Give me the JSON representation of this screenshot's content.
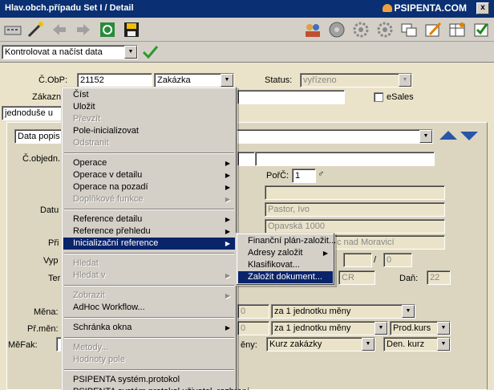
{
  "titlebar": {
    "title": "Hlav.obch.případu  Set I / Detail",
    "logo": "PSIPENTA.COM",
    "close": "x"
  },
  "toolbar": {
    "icons": [
      "keyboard-icon",
      "wand-icon",
      "arrow-left-icon",
      "arrow-right-icon",
      "refresh-icon",
      "save-icon",
      "users-icon",
      "disc-icon",
      "gear-icon",
      "gear2-icon",
      "windows-icon",
      "edit-icon",
      "table-icon",
      "check-doc-icon"
    ]
  },
  "action_bar": {
    "select_value": "Kontrolovat a načíst data",
    "confirm_icon": "checkmark-icon"
  },
  "header": {
    "cobp_label": "Č.ObP:",
    "cobp_value": "21152",
    "type_value": "Zakázka",
    "status_label": "Status:",
    "status_value": "vyřízeno",
    "customer_label": "Zákazník",
    "esales_label": "eSales",
    "mode_value": "jednoduše u"
  },
  "panel": {
    "data_select": "Data popis",
    "objedn_label": "Č.objedn.",
    "porc_label": "PořČ:",
    "porc_value": "1",
    "datum_label": "Datu",
    "contact_value": "Pastor, Ivo",
    "street_value": "Opavská 1000",
    "prijemce_label": "Při",
    "city_value": "c nad Moravicí",
    "vyp_label": "Vyp",
    "slash": "/",
    "vyp_value2": "0",
    "ter_label": "Ter",
    "country_value": "CR",
    "dan_label": "Daň:",
    "dan_value": "22",
    "mena_label": "Měna:",
    "mena_value": "0",
    "mena_unit": "za 1 jednotku měny",
    "prmen_label": "Př.měn:",
    "prmen_value": "0",
    "prmen_unit": "za 1 jednotku měny",
    "prod_kurs": "Prod.kurs",
    "mefak_label": "MěFak:",
    "meny_label": "ěny:",
    "kurs_zakazky": "Kurz zakázky",
    "den_kurz": "Den. kurz"
  },
  "context_menu": {
    "items": [
      {
        "label": "Číst",
        "disabled": false
      },
      {
        "label": "Uložit",
        "disabled": false
      },
      {
        "label": "Převzít",
        "disabled": true
      },
      {
        "label": "Pole-inicializovat",
        "disabled": false
      },
      {
        "label": "Odstranit",
        "disabled": true
      },
      {
        "sep": true
      },
      {
        "label": "Operace",
        "disabled": false,
        "sub": true
      },
      {
        "label": "Operace v detailu",
        "disabled": false,
        "sub": true
      },
      {
        "label": "Operace na pozadí",
        "disabled": false,
        "sub": true
      },
      {
        "label": "Doplňkové funkce",
        "disabled": true,
        "sub": true
      },
      {
        "sep": true
      },
      {
        "label": "Reference detailu",
        "disabled": false,
        "sub": true
      },
      {
        "label": "Reference přehledu",
        "disabled": false,
        "sub": true
      },
      {
        "label": "Inicializační reference",
        "disabled": false,
        "sub": true,
        "selected": true
      },
      {
        "sep": true
      },
      {
        "label": "Hledat",
        "disabled": true
      },
      {
        "label": "Hledat v",
        "disabled": true,
        "sub": true
      },
      {
        "sep": true
      },
      {
        "label": "Zobrazit",
        "disabled": true,
        "sub": true
      },
      {
        "label": "AdHoc Workflow...",
        "disabled": false
      },
      {
        "sep": true
      },
      {
        "label": "Schránka okna",
        "disabled": false,
        "sub": true
      },
      {
        "sep": true
      },
      {
        "label": "Metody...",
        "disabled": true
      },
      {
        "label": "Hodnoty pole",
        "disabled": true
      },
      {
        "sep": true
      },
      {
        "label": "PSIPENTA systém.protokol",
        "disabled": false
      },
      {
        "label": "PSIPENTA systém.protokol uživatel. rozhraní",
        "disabled": false
      }
    ]
  },
  "submenu": {
    "items": [
      {
        "label": "Finanční plán-založit...",
        "sub": false
      },
      {
        "label": "Adresy založit",
        "sub": true
      },
      {
        "label": "Klasifikovat...",
        "sub": false
      },
      {
        "label": "Založit dokument...",
        "sub": false,
        "selected": true
      }
    ]
  },
  "colors": {
    "title_bg": "#0a2f72",
    "menu_highlight": "#0a246a",
    "background": "#ebe3c9",
    "nav_arrow": "#2856a8"
  }
}
